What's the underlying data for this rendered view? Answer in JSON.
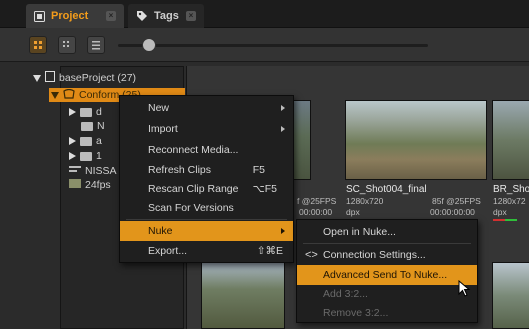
{
  "tabs": [
    {
      "label": "Project",
      "active": true
    },
    {
      "label": "Tags",
      "active": false
    }
  ],
  "toolbar": {
    "view_buttons": [
      "grid-large-view",
      "grid-small-view",
      "list-view"
    ],
    "thumbnail_size_fraction": 0.1
  },
  "tree": {
    "root": "baseProject (27)",
    "selected": "Conform (25)",
    "partial_items": [
      "d",
      "N",
      "a",
      "1",
      "NISSA",
      "24fps"
    ]
  },
  "clips": [
    {
      "name": "SC_Shot004_final",
      "res": "1280x720",
      "fps": "85f @25FPS",
      "format": "dpx",
      "tc": "00:00:00:00"
    },
    {
      "name": "BR_Sho",
      "res": "1280x72",
      "fps": "",
      "format": "dpx",
      "tc": ""
    },
    {
      "name": "",
      "res": "",
      "fps": "f @25FPS",
      "format": "",
      "tc": "00:00:00"
    }
  ],
  "context_menu": {
    "items": [
      {
        "label": "New",
        "shortcut": "",
        "submenu": true
      },
      {
        "label": "Import",
        "shortcut": "",
        "submenu": true
      },
      {
        "label": "Reconnect Media...",
        "shortcut": ""
      },
      {
        "label": "Refresh Clips",
        "shortcut": "F5"
      },
      {
        "label": "Rescan Clip Range",
        "shortcut": "⌥F5"
      },
      {
        "label": "Scan For Versions",
        "shortcut": ""
      },
      {
        "label": "Nuke",
        "shortcut": "",
        "submenu": true,
        "highlighted": true
      },
      {
        "label": "Export...",
        "shortcut": "⇧⌘E"
      }
    ]
  },
  "nuke_submenu": {
    "items": [
      {
        "label": "Open in Nuke...",
        "enabled": true
      },
      {
        "label": "Connection Settings...",
        "enabled": true
      },
      {
        "label": "Advanced Send To Nuke...",
        "enabled": true,
        "highlighted": true
      },
      {
        "label": "Add 3:2...",
        "enabled": false
      },
      {
        "label": "Remove 3:2...",
        "enabled": false
      }
    ]
  },
  "colors": {
    "accent": "#e2951b",
    "menu_bg": "#1f1f1f",
    "disabled_text": "#6a6a6a"
  }
}
